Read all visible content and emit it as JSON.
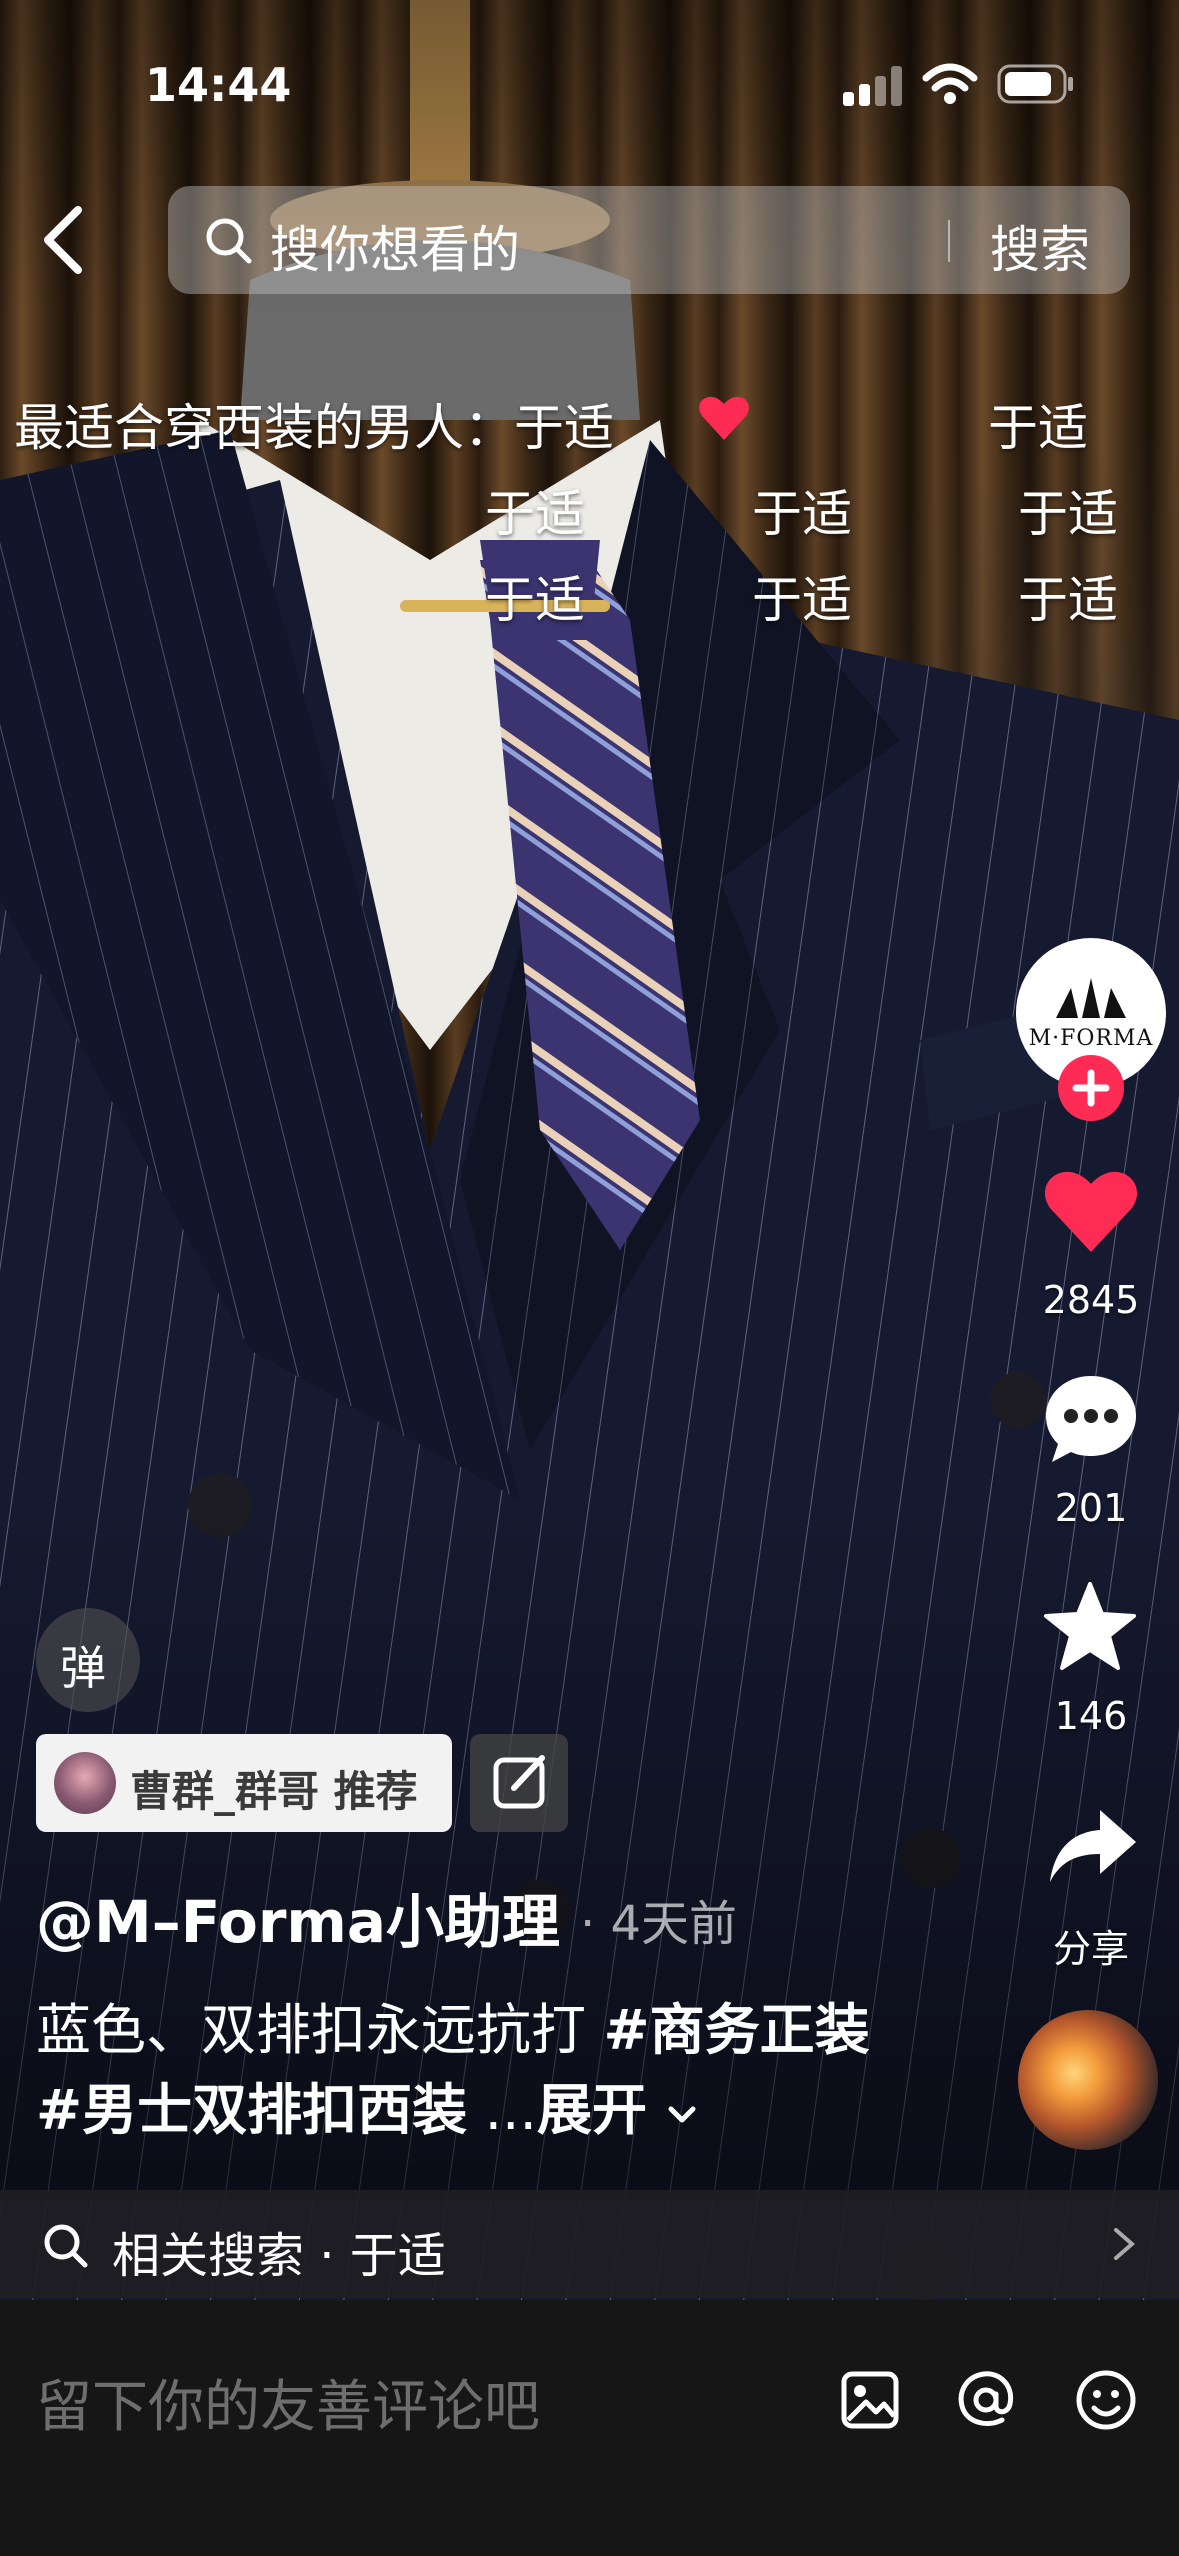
{
  "status_bar": {
    "time": "14:44"
  },
  "search": {
    "placeholder": "搜你想看的",
    "button": "搜索"
  },
  "danmaku": [
    "最适合穿西装的男人：于适",
    "于适",
    "于适",
    "于适",
    "于适",
    "于适",
    "于适",
    "于适"
  ],
  "creator": {
    "brand": "M·FORMA"
  },
  "rail": {
    "likes": "2845",
    "comments": "201",
    "favorites": "146",
    "share_label": "分享"
  },
  "danmaku_toggle": {
    "label": "弹"
  },
  "recommend": {
    "text": "曹群_群哥 推荐"
  },
  "post": {
    "author": "@M–Forma小助理",
    "time_ago": "· 4天前",
    "caption_text": "蓝色、双排扣永远抗打 ",
    "tag1": "#商务正装",
    "tag2": "#男士双排扣西装",
    "ellipsis": " ...",
    "expand": "展开"
  },
  "related_search": {
    "label": "相关搜索 · 于适"
  },
  "comment_input": {
    "placeholder": "留下你的友善评论吧"
  },
  "colors": {
    "like_red": "#fe2c55",
    "comment_bar": "#161616"
  }
}
